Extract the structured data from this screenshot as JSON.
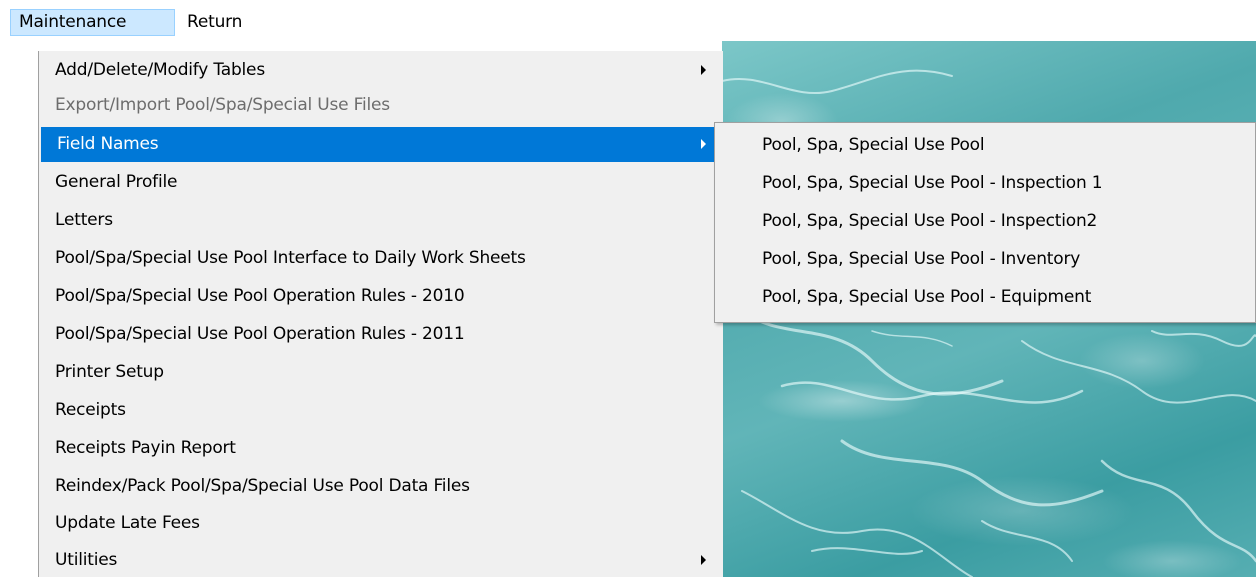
{
  "menubar": {
    "items": [
      {
        "label": "Maintenance"
      },
      {
        "label": "Return"
      }
    ]
  },
  "dropdown": {
    "items": [
      {
        "label": "Add/Delete/Modify Tables"
      },
      {
        "label": "Export/Import Pool/Spa/Special Use Files"
      },
      {
        "label": "Field Names"
      },
      {
        "label": "General Profile"
      },
      {
        "label": "Letters"
      },
      {
        "label": "Pool/Spa/Special Use Pool Interface to Daily Work Sheets"
      },
      {
        "label": "Pool/Spa/Special Use Pool Operation Rules - 2010"
      },
      {
        "label": "Pool/Spa/Special Use Pool Operation Rules - 2011"
      },
      {
        "label": "Printer Setup"
      },
      {
        "label": "Receipts"
      },
      {
        "label": "Receipts Payin Report"
      },
      {
        "label": "Reindex/Pack Pool/Spa/Special Use Pool Data Files"
      },
      {
        "label": "Update Late Fees"
      },
      {
        "label": "Utilities"
      }
    ]
  },
  "submenu": {
    "items": [
      {
        "label": "Pool, Spa, Special Use Pool"
      },
      {
        "label": "Pool, Spa, Special Use Pool - Inspection 1"
      },
      {
        "label": "Pool, Spa, Special Use Pool - Inspection2"
      },
      {
        "label": "Pool, Spa, Special Use Pool - Inventory"
      },
      {
        "label": "Pool, Spa, Special Use Pool - Equipment"
      }
    ]
  },
  "colors": {
    "highlight": "#0078d7",
    "menu_background": "#f0f0f0",
    "active_menubar": "#cce8ff",
    "disabled_text": "#6d6d6d",
    "water": "#4fa9ad"
  }
}
